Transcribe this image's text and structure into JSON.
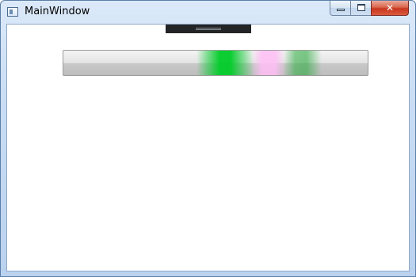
{
  "window": {
    "title": "MainWindow",
    "icon": "app-window-icon"
  },
  "titlebar_controls": {
    "minimize_icon": "minimize-icon",
    "maximize_icon": "maximize-icon",
    "close_icon": "close-icon",
    "close_glyph": "✕"
  },
  "colors": {
    "frame": "#c8dcf3",
    "client_background": "#ffffff",
    "handle": "#222426",
    "meter_track": "#d0d0d0",
    "accent_green": "#00cc28",
    "accent_pink": "#ffbef5",
    "accent_green_dim": "#28aa3c",
    "close_button": "#c8361f"
  }
}
